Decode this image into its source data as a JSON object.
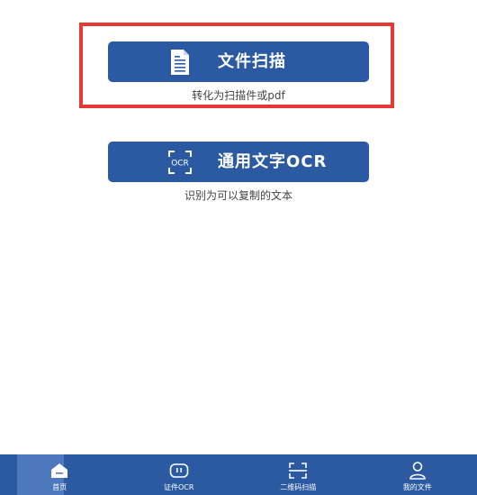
{
  "actions": {
    "scan": {
      "label": "文件扫描",
      "subtitle": "转化为扫描件或pdf",
      "icon": "document-icon"
    },
    "ocr": {
      "label": "通用文字OCR",
      "subtitle": "识别为可以复制的文本",
      "icon": "ocr-scan-icon",
      "icon_text": "OCR"
    }
  },
  "tabs": [
    {
      "label": "首页",
      "icon": "home-icon",
      "active": true
    },
    {
      "label": "证件OCR",
      "icon": "id-card-icon",
      "active": false
    },
    {
      "label": "二维码扫描",
      "icon": "qr-scan-icon",
      "active": false
    },
    {
      "label": "我的文件",
      "icon": "user-icon",
      "active": false
    }
  ],
  "colors": {
    "primary": "#2b5aa3",
    "active_tab": "#4d78bd",
    "highlight": "#e53935"
  }
}
